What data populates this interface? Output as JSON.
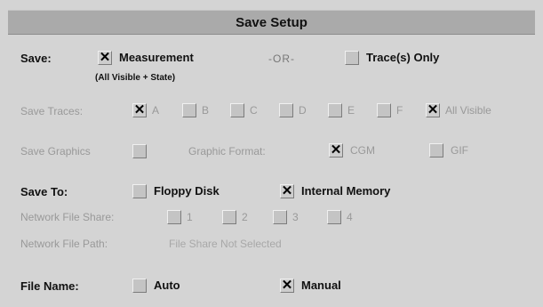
{
  "title": "Save Setup",
  "save": {
    "label": "Save:",
    "measurement": "Measurement",
    "measurement_sub": "(All Visible + State)",
    "or": "-OR-",
    "traces_only": "Trace(s) Only"
  },
  "save_traces": {
    "label": "Save Traces:",
    "a": "A",
    "b": "B",
    "c": "C",
    "d": "D",
    "e": "E",
    "f": "F",
    "all_visible": "All Visible"
  },
  "save_graphics": {
    "label": "Save Graphics",
    "format_label": "Graphic Format:",
    "cgm": "CGM",
    "gif": "GIF"
  },
  "save_to": {
    "label": "Save To:",
    "floppy": "Floppy Disk",
    "internal": "Internal Memory"
  },
  "network_share": {
    "label": "Network File Share:",
    "s1": "1",
    "s2": "2",
    "s3": "3",
    "s4": "4"
  },
  "network_path": {
    "label": "Network File Path:",
    "value": "File Share Not Selected"
  },
  "file_name": {
    "label": "File Name:",
    "auto": "Auto",
    "manual": "Manual"
  },
  "colors": {
    "background": "#d4d4d4",
    "title_bar": "#aaaaaa",
    "disabled_text": "#999999"
  }
}
